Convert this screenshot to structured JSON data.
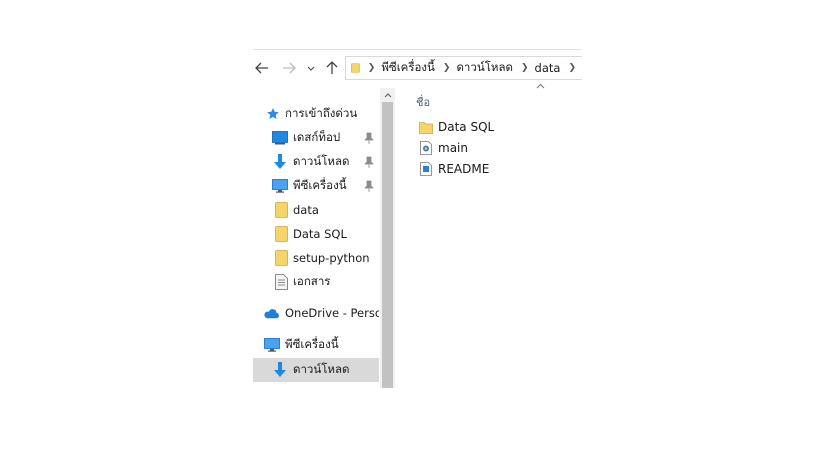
{
  "address_bar": {
    "crumbs": [
      "พีซีเครื่องนี้",
      "ดาวน์โหลด",
      "data"
    ]
  },
  "nav_pane": {
    "items": [
      {
        "label": "การเข้าถึงด่วน",
        "icon": "star-icon"
      },
      {
        "label": "เดสก์ท็อป",
        "icon": "desktop-icon",
        "pinned": true
      },
      {
        "label": "ดาวน์โหลด",
        "icon": "download-icon",
        "pinned": true
      },
      {
        "label": "พีซีเครื่องนี้",
        "icon": "monitor-icon",
        "pinned": true
      },
      {
        "label": "data",
        "icon": "folder-icon"
      },
      {
        "label": "Data SQL",
        "icon": "folder-icon"
      },
      {
        "label": "setup-python",
        "icon": "folder-icon"
      },
      {
        "label": "เอกสาร",
        "icon": "document-icon"
      },
      {
        "label": "OneDrive - Persor",
        "icon": "cloud-icon"
      },
      {
        "label": "พีซีเครื่องนี้",
        "icon": "monitor-icon"
      },
      {
        "label": "ดาวน์โหลด",
        "icon": "download-icon",
        "selected": true
      }
    ]
  },
  "content": {
    "column_header": "ชื่อ",
    "files": [
      {
        "name": "Data SQL",
        "icon": "folder-icon"
      },
      {
        "name": "main",
        "icon": "python-file-icon"
      },
      {
        "name": "README",
        "icon": "text-file-icon"
      }
    ]
  },
  "colors": {
    "folder": "#f5d56a",
    "accent_blue": "#1e88e5",
    "selected_bg": "#d9d9d9",
    "header_text": "#4c607a"
  }
}
